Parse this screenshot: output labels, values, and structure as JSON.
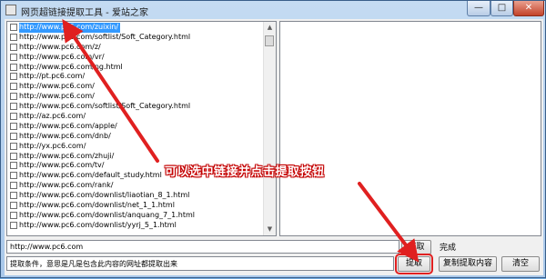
{
  "window": {
    "title": "网页超链接提取工具 - 爱站之家",
    "min_label": "—",
    "max_label": "□",
    "close_label": "✕"
  },
  "links": [
    "http://www.pc6.com/zuixin/",
    "http://www.pc6.com/softlist/Soft_Category.html",
    "http://www.pc6.com/z/",
    "http://www.pc6.com/vr/",
    "http://www.pc6.com/ng.html",
    "http://pt.pc6.com/",
    "http://www.pc6.com/",
    "http://www.pc6.com/",
    "http://www.pc6.com/softlist/Soft_Category.html",
    "http://az.pc6.com/",
    "http://www.pc6.com/apple/",
    "http://www.pc6.com/dnb/",
    "http://yx.pc6.com/",
    "http://www.pc6.com/zhuji/",
    "http://www.pc6.com/tv/",
    "http://www.pc6.com/default_study.html",
    "http://www.pc6.com/rank/",
    "http://www.pc6.com/downlist/liaotian_8_1.html",
    "http://www.pc6.com/downlist/net_1_1.html",
    "http://www.pc6.com/downlist/anquang_7_1.html",
    "http://www.pc6.com/downlist/yyrj_5_1.html"
  ],
  "selected_index": 0,
  "url_input": {
    "value": "http://www.pc6.com"
  },
  "fetch_button": {
    "label": "获取"
  },
  "status_text": "完成",
  "condition_text": "提取条件，意思是凡是包含此内容的网址都提取出来",
  "buttons": {
    "extract": "提取",
    "copy": "复制提取内容",
    "clear": "清空"
  },
  "annotation": {
    "text": "可以选中链接并点击提取按钮"
  },
  "colors": {
    "accent": "#e02020",
    "selection": "#3399ff"
  }
}
